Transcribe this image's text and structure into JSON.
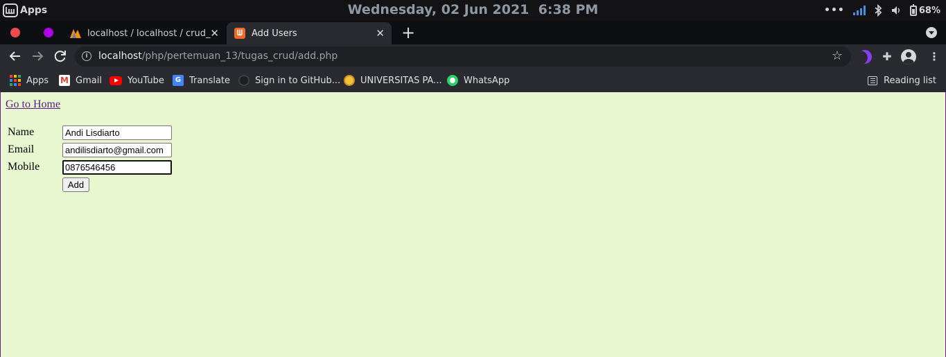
{
  "os_panel": {
    "menu_label": "Apps",
    "clock": "Wednesday, 02 Jun 2021  6:38 PM",
    "battery": "68%",
    "battery_level": 0.68
  },
  "browser": {
    "tabs": [
      {
        "title": "localhost / localhost / crud_db",
        "favicon": "phpmyadmin-icon",
        "active": false
      },
      {
        "title": "Add Users",
        "favicon": "xampp-icon",
        "active": true
      }
    ],
    "close_glyph": "✕",
    "new_tab_glyph": "+",
    "url_host": "localhost",
    "url_path": "/php/pertemuan_13/tugas_crud/add.php",
    "bookmarks": [
      {
        "label": "Apps",
        "icon": "apps-grid-icon"
      },
      {
        "label": "Gmail",
        "icon": "gmail-icon"
      },
      {
        "label": "YouTube",
        "icon": "youtube-icon"
      },
      {
        "label": "Translate",
        "icon": "translate-icon"
      },
      {
        "label": "Sign in to GitHub...",
        "icon": "github-icon"
      },
      {
        "label": "UNIVERSITAS PA...",
        "icon": "university-icon"
      },
      {
        "label": "WhatsApp",
        "icon": "whatsapp-icon"
      }
    ],
    "reading_list": "Reading list"
  },
  "colors": {
    "page_background": "#e9f7d0",
    "link_visited": "#551a8b",
    "tab_active": "#2a2b30",
    "xampp_orange": "#ee6a2b"
  },
  "page": {
    "home_link": "Go to Home",
    "form": {
      "name_label": "Name",
      "name_value": "Andi Lisdiarto",
      "email_label": "Email",
      "email_value": "andilisdiarto@gmail.com",
      "mobile_label": "Mobile",
      "mobile_value": "0876546456",
      "submit_label": "Add"
    }
  }
}
